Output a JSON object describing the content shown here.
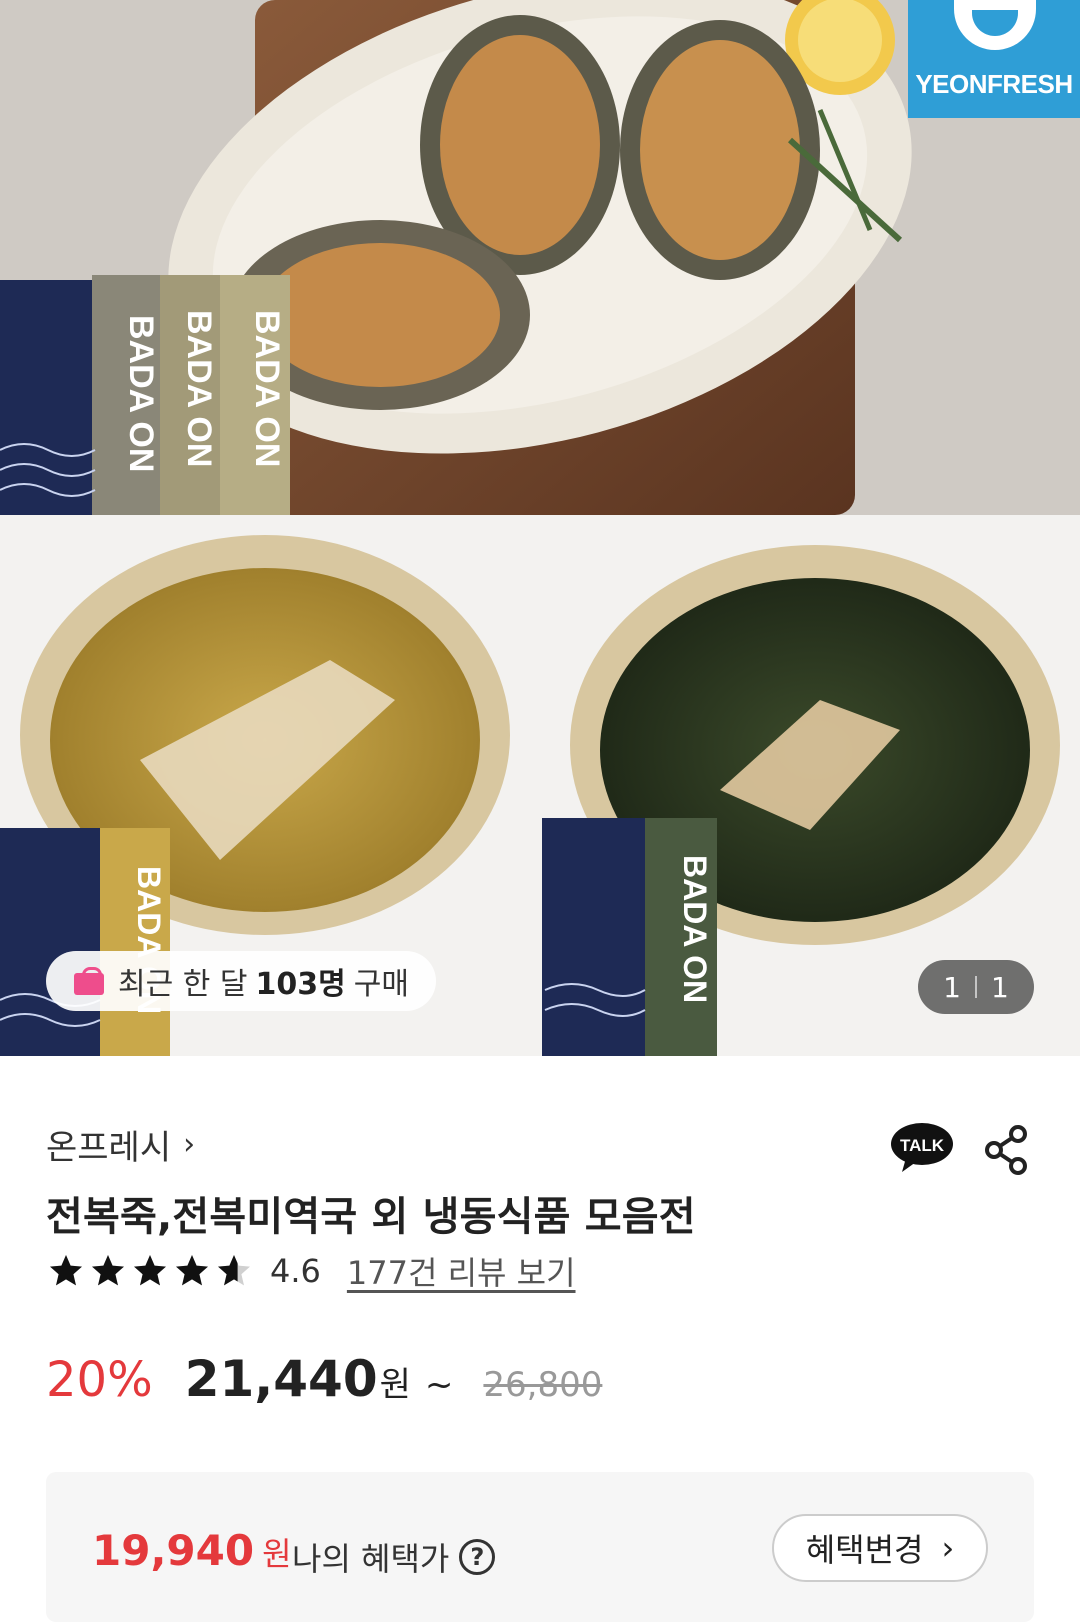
{
  "hero": {
    "brand_logo_text": "YEONFRESH",
    "package_text": "BADA ON",
    "purchase_badge": {
      "prefix": "최근 한 달",
      "count": "103명",
      "suffix": "구매"
    },
    "page_counter": {
      "current": "1",
      "total": "1"
    }
  },
  "product": {
    "seller": "온프레시",
    "title": "전복죽,전복미역국 외 냉동식품 모음전",
    "rating": "4.6",
    "rating_value": 4.6,
    "review_link": "177건 리뷰 보기",
    "discount": "20%",
    "sale_price": "21,440",
    "currency": "원",
    "range_mark": "~",
    "original_price": "26,800"
  },
  "benefit": {
    "price": "19,940",
    "currency": "원",
    "label": "나의 혜택가",
    "help_icon": "?",
    "change_button": "혜택변경"
  },
  "icons": {
    "talk": "TALK",
    "share": "share-icon"
  },
  "colors": {
    "accent_red": "#e4393c",
    "brand_blue": "#2f9ed6",
    "package_navy": "#1e2a55"
  }
}
